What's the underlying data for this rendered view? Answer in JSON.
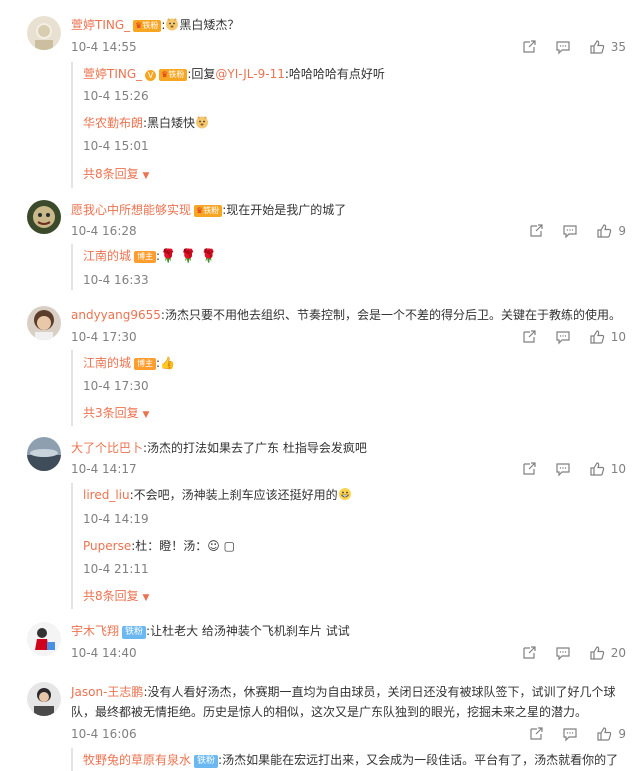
{
  "comments": [
    {
      "user": "萱婷TING_",
      "badge": "铁粉",
      "text": "黑白矮杰？",
      "time": "10-4 14:55",
      "likes": "35",
      "replies": [
        {
          "user": "萱婷TING_",
          "badge": "铁粉",
          "text": "回复",
          "mention": "@YI-JL-9-11",
          "text2": ":哈哈哈哈有点好听",
          "time": "10-4 15:26"
        },
        {
          "user": "华农勤布朗",
          "text": ":黑白矮快",
          "time": "10-4 15:01"
        }
      ],
      "more": "共8条回复"
    },
    {
      "user": "愿我心中所想能够实现",
      "badge": "铁粉",
      "text": ":现在开始是我广的城了",
      "time": "10-4 16:28",
      "likes": "9",
      "replies": [
        {
          "user": "江南的城",
          "badge": "博主",
          "text": ":",
          "time": "10-4 16:33"
        }
      ]
    },
    {
      "user": "andyyang9655",
      "text": ":汤杰只要不用他去组织、节奏控制，会是一个不差的得分后卫。关键在于教练的使用。",
      "time": "10-4 17:30",
      "likes": "10",
      "replies": [
        {
          "user": "江南的城",
          "badge": "博主",
          "text": ":",
          "time": "10-4 17:30"
        }
      ],
      "more": "共3条回复"
    },
    {
      "user": "大了个比巴卜",
      "text": ":汤杰的打法如果去了广东 杜指导会发疯吧",
      "time": "10-4 14:17",
      "likes": "10",
      "replies": [
        {
          "user": "lired_liu",
          "text": ":不会吧，汤神装上刹车应该还挺好用的",
          "time": "10-4 14:19"
        },
        {
          "user": "Puperse",
          "text": ":杜：瞪！汤：☺ ▢",
          "time": "10-4 21:11"
        }
      ],
      "more": "共8条回复"
    },
    {
      "user": "宇木飞翔",
      "badge": "铁粉",
      "text": ":让杜老大 给汤神装个飞机刹车片 试试",
      "time": "10-4 14:40",
      "likes": "20"
    },
    {
      "user": "Jason-王志鹏",
      "text": ":没有人看好汤杰，休赛期一直均为自由球员，关闭日还没有被球队签下，试训了好几个球",
      "text_line2": "队，最终都被无情拒绝。历史是惊人的相似，这次又是广东队独到的眼光，挖掘未来之星的潜力。",
      "time": "10-4 16:06",
      "likes": "9",
      "replies": [
        {
          "user": "牧野兔的草原有泉水",
          "badge": "铁粉",
          "text": ":汤杰如果能在宏远打出来，又会成为一段佳话。平台有了，汤杰就看你的了"
        }
      ]
    }
  ],
  "colors": {
    "username": "#eb7350",
    "muted": "#808080",
    "text": "#333333"
  }
}
